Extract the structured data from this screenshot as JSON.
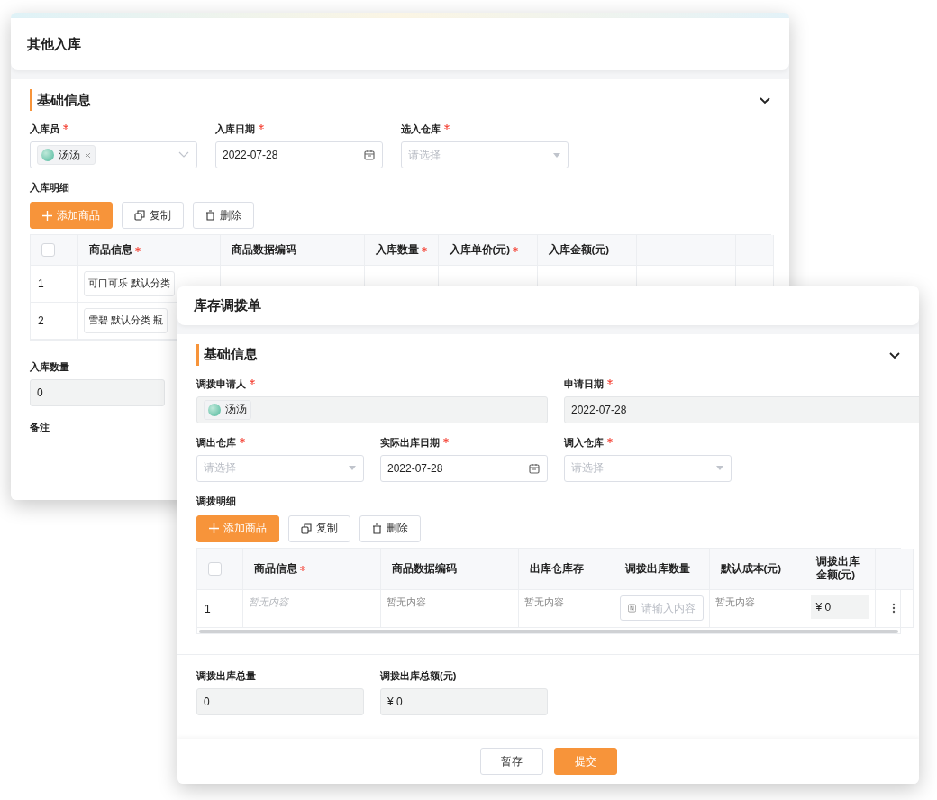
{
  "back_window": {
    "title": "其他入库",
    "section": {
      "title": "基础信息",
      "expanded": true
    },
    "field_rows": [
      [
        {
          "label": "入库员",
          "required": true,
          "kind": "tag-select",
          "disabled": false,
          "tag": {
            "name": "汤汤",
            "removable": true
          }
        },
        {
          "label": "入库日期",
          "required": true,
          "kind": "date",
          "disabled": false,
          "value": "2022-07-28"
        },
        {
          "label": "选入仓库",
          "required": true,
          "kind": "select",
          "disabled": false,
          "placeholder": "请选择"
        }
      ]
    ],
    "detail_label": "入库明细",
    "toolbar": [
      {
        "label": "添加商品",
        "kind": "primary"
      },
      {
        "label": "复制",
        "kind": "copy"
      },
      {
        "label": "删除",
        "kind": "delete"
      }
    ],
    "table": {
      "select_all": {
        "checked": false
      },
      "columns": [
        {
          "label": "商品信息",
          "required": true
        },
        {
          "label": "商品数据编码",
          "required": false
        },
        {
          "label": "入库数量",
          "required": true
        },
        {
          "label": "入库单价(元)",
          "required": true
        },
        {
          "label": "入库金额(元)",
          "required": false
        }
      ],
      "rows": [
        {
          "index": "1",
          "cells": [
            {
              "kind": "input",
              "value": "可口可乐 默认分类"
            }
          ]
        },
        {
          "index": "2",
          "cells": [
            {
              "kind": "input",
              "value": "雪碧 默认分类 瓶"
            }
          ]
        }
      ]
    },
    "summary": [
      {
        "label": "入库数量",
        "required": false,
        "kind": "text",
        "disabled": true,
        "value": "0"
      }
    ],
    "remark_label": "备注"
  },
  "front_window": {
    "title": "库存调拨单",
    "section": {
      "title": "基础信息",
      "expanded": true
    },
    "field_rows": [
      [
        {
          "label": "调拨申请人",
          "required": true,
          "kind": "tag-select",
          "disabled": true,
          "tag": {
            "name": "汤汤",
            "removable": false
          }
        },
        {
          "label": "申请日期",
          "required": true,
          "kind": "text",
          "disabled": true,
          "value": "2022-07-28"
        }
      ],
      [
        {
          "label": "调出仓库",
          "required": true,
          "kind": "select",
          "disabled": false,
          "placeholder": "请选择"
        },
        {
          "label": "实际出库日期",
          "required": true,
          "kind": "date",
          "disabled": false,
          "value": "2022-07-28"
        },
        {
          "label": "调入仓库",
          "required": true,
          "kind": "select",
          "disabled": false,
          "placeholder": "请选择"
        }
      ]
    ],
    "detail_label": "调拨明细",
    "toolbar": [
      {
        "label": "添加商品",
        "kind": "primary"
      },
      {
        "label": "复制",
        "kind": "copy"
      },
      {
        "label": "删除",
        "kind": "delete"
      }
    ],
    "table": {
      "select_all": {
        "checked": false
      },
      "columns": [
        {
          "label": "商品信息",
          "required": true
        },
        {
          "label": "商品数据编码",
          "required": false
        },
        {
          "label": "出库仓库存",
          "required": false
        },
        {
          "label": "调拨出库数量",
          "required": false
        },
        {
          "label": "默认成本(元)",
          "required": false
        },
        {
          "label": "调拨出库金额(元)",
          "required": false
        }
      ],
      "rows": [
        {
          "index": "1",
          "cells": [
            {
              "kind": "hint",
              "value": "暂无内容"
            },
            {
              "kind": "empty",
              "value": "暂无内容"
            },
            {
              "kind": "empty",
              "value": "暂无内容"
            },
            {
              "kind": "number-input",
              "placeholder": "请输入内容"
            },
            {
              "kind": "empty",
              "value": "暂无内容"
            },
            {
              "kind": "amount",
              "value": "¥ 0"
            }
          ],
          "has_menu": true
        }
      ]
    },
    "summary": [
      {
        "label": "调拨出库总量",
        "required": false,
        "kind": "text",
        "disabled": true,
        "value": "0"
      },
      {
        "label": "调拨出库总额(元)",
        "required": false,
        "kind": "text",
        "disabled": true,
        "value": "¥ 0"
      }
    ],
    "footer_buttons": [
      {
        "label": "暂存",
        "kind": "default"
      },
      {
        "label": "提交",
        "kind": "primary"
      }
    ]
  }
}
